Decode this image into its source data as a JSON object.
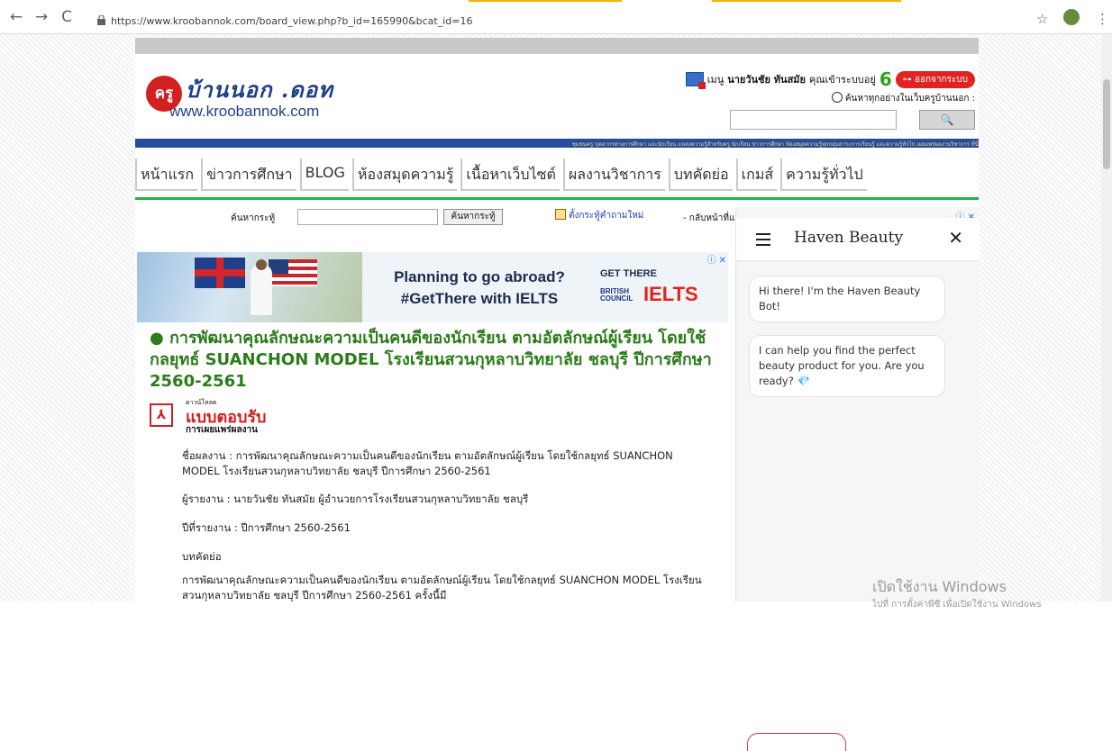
{
  "browser": {
    "url": "https://www.kroobannok.com/board_view.php?b_id=165990&bcat_id=16",
    "back_icon": "←",
    "forward_icon": "→",
    "reload_icon": "C",
    "bookmark_icon": "☆",
    "menu_icon": "⋮"
  },
  "header": {
    "logo_badge": "ครู",
    "logo_thai": "บ้านนอก .ดอท",
    "logo_url": "www.kroobannok.com",
    "menu_label": "เมนู",
    "user_name": "นายวันชัย ทันสมัย",
    "visit_label": "คุณเข้าระบบอยู่",
    "visit_count": "6",
    "logout_label": "ออกจากระบบ",
    "search_hint": "ค้นหาทุกอย่างในเว็บครูบ้านนอก :",
    "search_button": "🔍",
    "banner_text": "ชุมชนครู บุคลากรทางการศึกษา และนักเรียน แหล่งความรู้สำหรับครู นักเรียน ข่าวการศึกษา ห้องสมุดความรู้ทุกกลุ่มสาระการเรียนรู้ และความรู้ทั่วไป เผยแพร่ผลงานวิชาการ ที่นี่"
  },
  "nav": {
    "items": [
      "หน้าแรก",
      "ข่าวการศึกษา",
      "BLOG",
      "ห้องสมุดความรู้",
      "เนื้อหาเว็บไซต์",
      "ผลงานวิชาการ",
      "บทคัดย่อ",
      "เกมส์",
      "ความรู้ทั่วไป"
    ]
  },
  "topic_search": {
    "label": "ค้นหากระทู้",
    "button": "ค้นหากระทู้",
    "new_topic": "ตั้งกระทู้คำถามใหม่",
    "back": "- กลับหน้าที่แล้ว"
  },
  "ad": {
    "headline_1": "Planning to go abroad?",
    "headline_2": "#GetThere with IELTS",
    "get_there": "GET THERE",
    "council_1": "BRITISH",
    "council_2": "COUNCIL",
    "ielts": "IELTS",
    "adchoice": "ⓘ ✕"
  },
  "article": {
    "title": "● การพัฒนาคุณลักษณะความเป็นคนดีของนักเรียน ตามอัตลักษณ์ผู้เรียน โดยใช้กลยุทธ์ SUANCHON MODEL โรงเรียนสวนกุหลาบวิทยาลัย ชลบุรี ปีการศึกษา 2560-2561",
    "pdf_small": "ดาวน์โหลด",
    "pdf_big": "แบบตอบรับ",
    "pdf_sub": "การเผยแพร่ผลงาน",
    "work_name": "ชื่อผลงาน : การพัฒนาคุณลักษณะความเป็นคนดีของนักเรียน ตามอัตลักษณ์ผู้เรียน โดยใช้กลยุทธ์ SUANCHON MODEL โรงเรียนสวนกุหลาบวิทยาลัย ชลบุรี ปีการศึกษา 2560-2561",
    "reporter": "ผู้รายงาน : นายวันชัย ทันสมัย ผู้อำนวยการโรงเรียนสวนกุหลาบวิทยาลัย ชลบุรี",
    "year": "ปีที่รายงาน : ปีการศึกษา 2560-2561",
    "abstract_heading": "บทคัดย่อ",
    "abstract_text": "การพัฒนาคุณลักษณะความเป็นคนดีของนักเรียน ตามอัตลักษณ์ผู้เรียน โดยใช้กลยุทธ์ SUANCHON MODEL โรงเรียนสวนกุหลาบวิทยาลัย ชลบุรี ปีการศึกษา 2560-2561 ครั้งนี้มี"
  },
  "chat": {
    "adchoice": "ⓘ ✕",
    "title": "Haven Beauty",
    "close": "✕",
    "message_1": "Hi there! I'm the Haven Beauty Bot!",
    "message_2": "I can help you find the perfect beauty product for you. Are you ready? 💎"
  },
  "watermark": {
    "line_1": "เปิดใช้งาน Windows",
    "line_2": "ไปที่ การตั้งค่าพีซี เพื่อเปิดใช้งาน Windows"
  }
}
